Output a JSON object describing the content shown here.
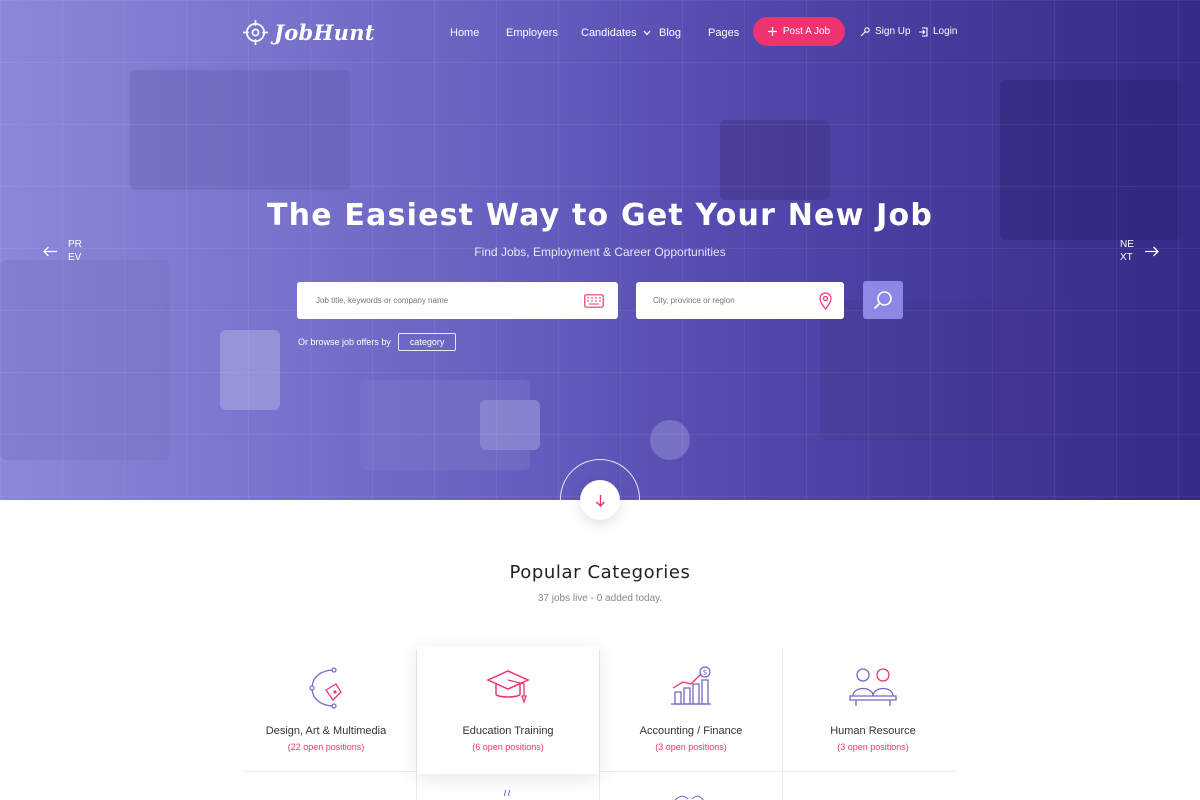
{
  "brand": {
    "name": "JobHunt"
  },
  "nav": {
    "items": [
      {
        "label": "Home"
      },
      {
        "label": "Employers"
      },
      {
        "label": "Candidates"
      },
      {
        "label": "Blog"
      },
      {
        "label": "Pages"
      }
    ],
    "post_job": "Post A Job",
    "sign_up": "Sign Up",
    "login": "Login"
  },
  "hero": {
    "title": "The Easiest Way to Get Your New Job",
    "subtitle": "Find Jobs, Employment & Career Opportunities",
    "prev": "PREV",
    "next": "NEXT",
    "search_keywords_placeholder": "Job title, keywords or company name",
    "search_location_placeholder": "City, province or region",
    "browse_text": "Or browse job offers by",
    "browse_chip": "category"
  },
  "categories": {
    "title": "Popular Categories",
    "subtitle": "37 jobs live - 0 added today.",
    "items": [
      {
        "name": "Design, Art & Multimedia",
        "count": "(22 open positions)",
        "icon": "pen-tool-icon"
      },
      {
        "name": "Education Training",
        "count": "(6 open positions)",
        "icon": "graduation-cap-icon"
      },
      {
        "name": "Accounting / Finance",
        "count": "(3 open positions)",
        "icon": "finance-chart-icon"
      },
      {
        "name": "Human Resource",
        "count": "(3 open positions)",
        "icon": "people-icon"
      }
    ]
  },
  "colors": {
    "accent": "#f0336f",
    "purple": "#8c88e6",
    "icon_stroke": "#6f6ac4"
  }
}
